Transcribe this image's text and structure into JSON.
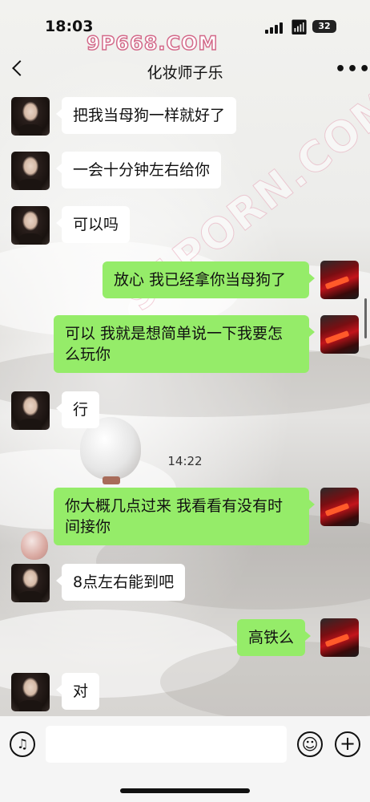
{
  "status": {
    "time": "18:03",
    "battery": "32"
  },
  "watermarks": {
    "top": "9P668.COM",
    "diagonal": "91PORN.COM"
  },
  "header": {
    "title": "化妆师子乐"
  },
  "messages": [
    {
      "side": "left",
      "avatar": "girl-avatar",
      "text": "把我当母狗一样就好了"
    },
    {
      "side": "left",
      "avatar": "girl-avatar",
      "text": "一会十分钟左右给你"
    },
    {
      "side": "left",
      "avatar": "girl-avatar",
      "text": "可以吗"
    },
    {
      "side": "right",
      "avatar": "car-avatar",
      "text": "放心 我已经拿你当母狗了"
    },
    {
      "side": "right",
      "avatar": "car-avatar",
      "text": "可以 我就是想简单说一下我要怎么玩你"
    },
    {
      "side": "left",
      "avatar": "girl-avatar",
      "text": "行"
    },
    {
      "side": "right",
      "avatar": "car-avatar",
      "text": "你大概几点过来 我看看有没有时间接你"
    },
    {
      "side": "left",
      "avatar": "girl-avatar",
      "text": "8点左右能到吧"
    },
    {
      "side": "right",
      "avatar": "car-avatar",
      "text": "高铁么"
    },
    {
      "side": "left",
      "avatar": "girl-avatar",
      "text": "对"
    }
  ],
  "timestamp": "14:22",
  "input": {
    "voice_icon": "voice-icon",
    "emoji_icon": "emoji-icon",
    "plus_icon": "plus-icon"
  },
  "colors": {
    "bubble_right": "#95ec69",
    "bubble_left": "#ffffff",
    "watermark_outline": "#d36a8a"
  }
}
